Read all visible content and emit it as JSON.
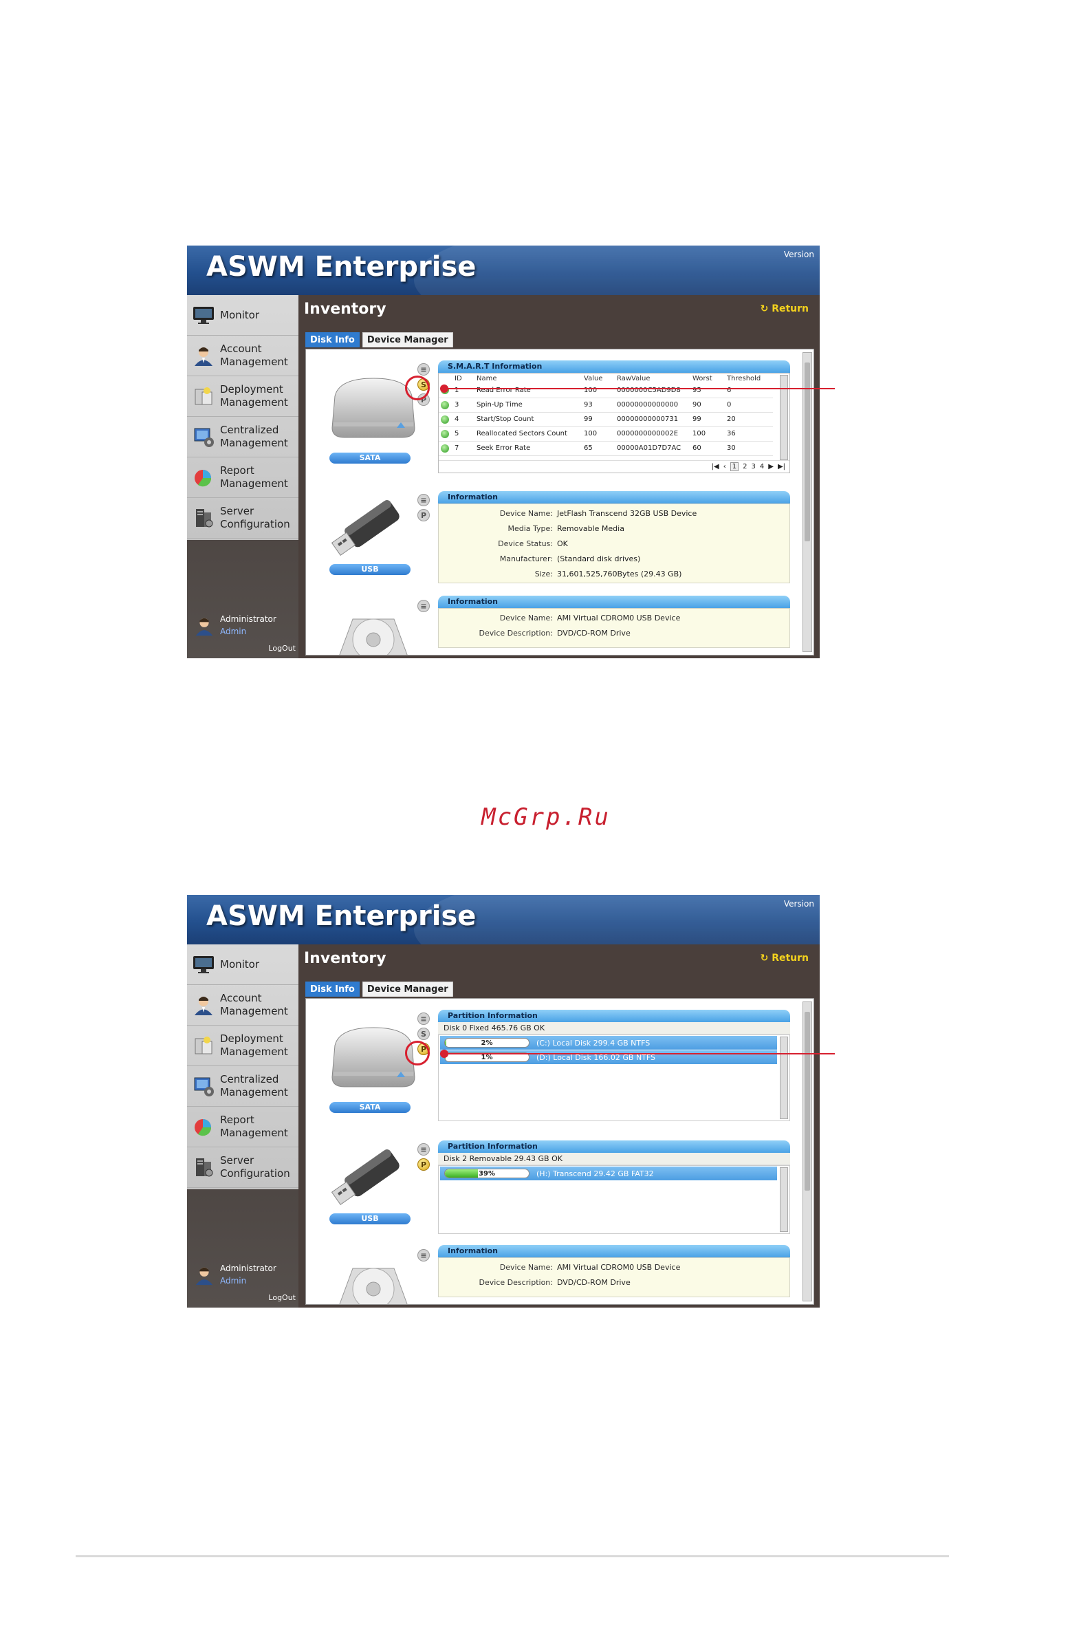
{
  "app": {
    "title": "ASWM Enterprise",
    "version_label": "Version"
  },
  "sidebar": {
    "items": [
      {
        "label": "Monitor",
        "icon": "monitor-icon"
      },
      {
        "label": "Account\nManagement",
        "icon": "account-icon"
      },
      {
        "label": "Deployment\nManagement",
        "icon": "deployment-icon"
      },
      {
        "label": "Centralized\nManagement",
        "icon": "centralized-icon"
      },
      {
        "label": "Report\nManagement",
        "icon": "report-icon"
      },
      {
        "label": "Server\nConfiguration",
        "icon": "server-icon"
      }
    ],
    "user_role": "Administrator",
    "user_name": "Admin",
    "logout": "LogOut"
  },
  "inventory": {
    "title": "Inventory",
    "return_label": "Return",
    "tabs": [
      {
        "label": "Disk Info"
      },
      {
        "label": "Device Manager"
      }
    ]
  },
  "devices": {
    "sata_caption": "SATA",
    "usb_caption": "USB",
    "s_button": "S",
    "p_button": "P"
  },
  "smart": {
    "header": "S.M.A.R.T Information",
    "columns": [
      "ID",
      "Name",
      "Value",
      "RawValue",
      "Worst",
      "Threshold"
    ],
    "rows": [
      {
        "id": "1",
        "name": "Read Error Rate",
        "value": "100",
        "raw": "0000000C5AD9D8",
        "worst": "95",
        "threshold": "6"
      },
      {
        "id": "3",
        "name": "Spin-Up Time",
        "value": "93",
        "raw": "00000000000000",
        "worst": "90",
        "threshold": "0"
      },
      {
        "id": "4",
        "name": "Start/Stop Count",
        "value": "99",
        "raw": "00000000000731",
        "worst": "99",
        "threshold": "20"
      },
      {
        "id": "5",
        "name": "Reallocated Sectors Count",
        "value": "100",
        "raw": "0000000000002E",
        "worst": "100",
        "threshold": "36"
      },
      {
        "id": "7",
        "name": "Seek Error Rate",
        "value": "65",
        "raw": "00000A01D7D7AC",
        "worst": "60",
        "threshold": "30"
      }
    ],
    "pages": [
      "1",
      "2",
      "3",
      "4"
    ]
  },
  "usb_info": {
    "header": "Information",
    "rows": [
      {
        "key": "Device Name:",
        "value": "JetFlash Transcend 32GB USB Device"
      },
      {
        "key": "Media Type:",
        "value": "Removable Media"
      },
      {
        "key": "Device Status:",
        "value": "OK"
      },
      {
        "key": "Manufacturer:",
        "value": "(Standard disk drives)"
      },
      {
        "key": "Size:",
        "value": "31,601,525,760Bytes (29.43 GB)"
      }
    ]
  },
  "cdrom_info": {
    "header": "Information",
    "rows": [
      {
        "key": "Device Name:",
        "value": "AMI Virtual CDROM0 USB Device"
      },
      {
        "key": "Device Description:",
        "value": "DVD/CD-ROM Drive"
      }
    ]
  },
  "partition_sata": {
    "header": "Partition Information",
    "disk_line": "Disk 0 Fixed  465.76 GB  OK",
    "partitions": [
      {
        "percent_label": "2%",
        "percent": 2,
        "label": "(C:) Local Disk  299.4 GB  NTFS"
      },
      {
        "percent_label": "1%",
        "percent": 1,
        "label": "(D:) Local Disk  166.02 GB  NTFS"
      }
    ]
  },
  "partition_usb": {
    "header": "Partition Information",
    "disk_line": "Disk 2 Removable  29.43 GB  OK",
    "partitions": [
      {
        "percent_label": "39%",
        "percent": 39,
        "label": "(H:) Transcend  29.42 GB  FAT32"
      }
    ]
  },
  "watermark": "McGrp.Ru",
  "colors": {
    "accent": "#2f7bcf",
    "callout": "#d7202f",
    "return": "#f4d21d"
  }
}
